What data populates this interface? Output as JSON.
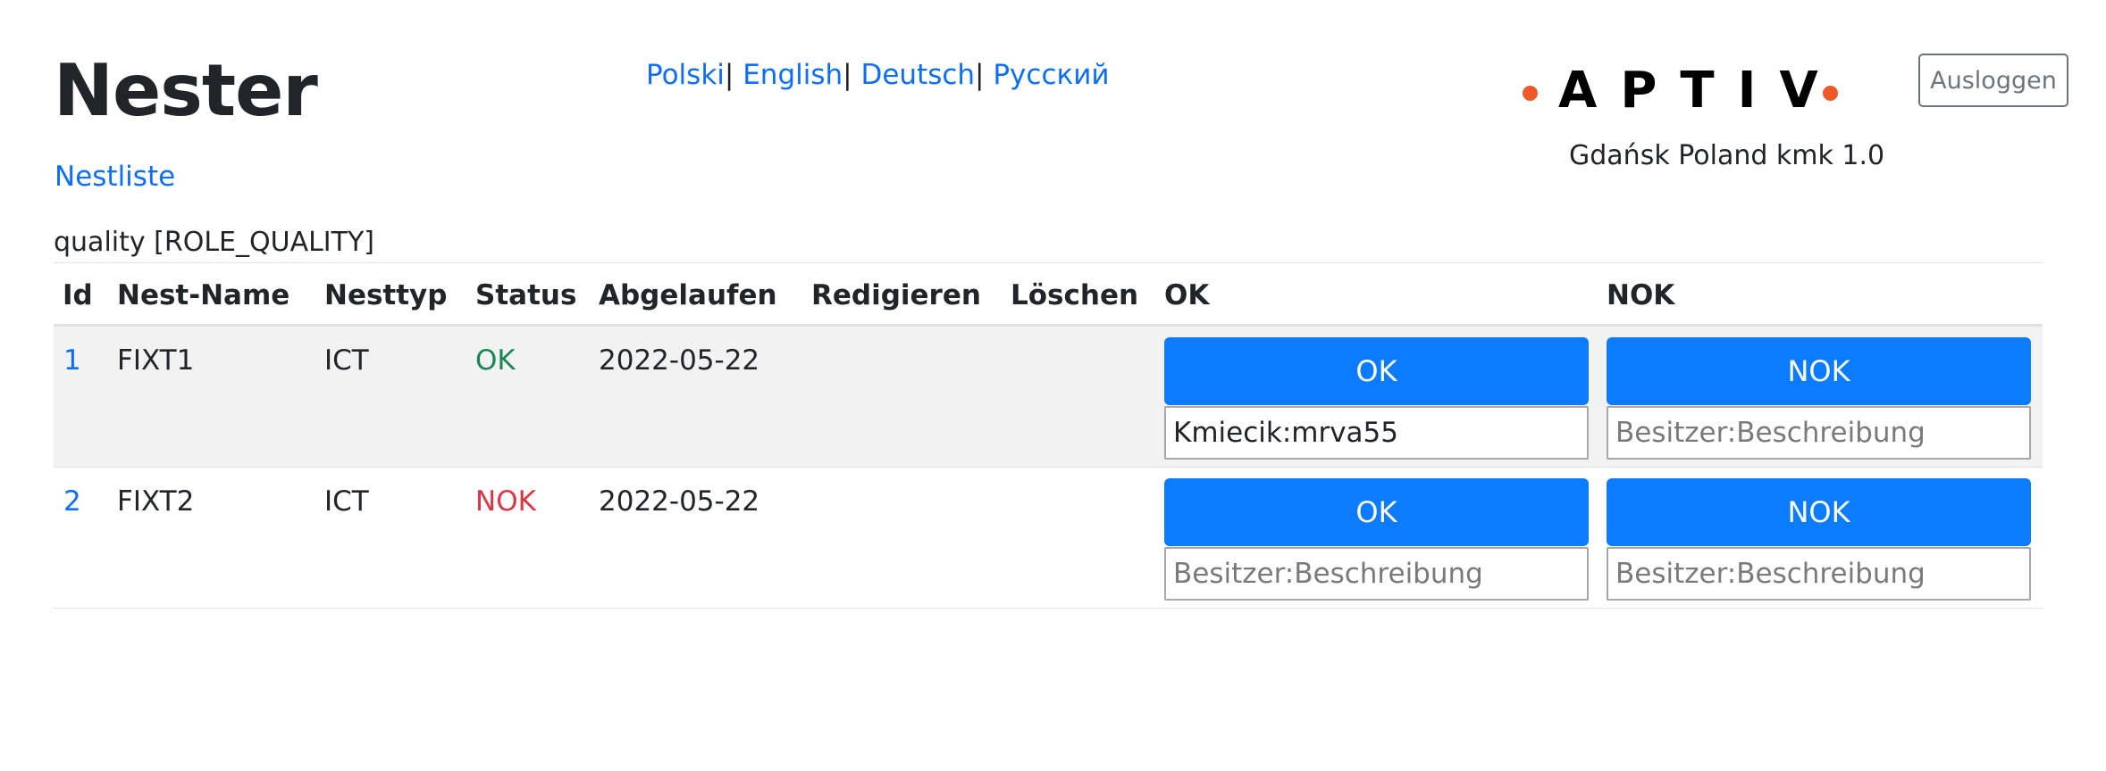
{
  "header": {
    "title": "Nester",
    "nav_link": "Nestliste",
    "languages": [
      "Polski",
      "English",
      "Deutsch",
      "Русский"
    ],
    "separator": "|",
    "logo_text": "APTIV",
    "subtitle": "Gdańsk Poland kmk 1.0",
    "logout_label": "Ausloggen",
    "user": "quality [ROLE_QUALITY]"
  },
  "table": {
    "columns": [
      "Id",
      "Nest-Name",
      "Nesttyp",
      "Status",
      "Abgelaufen",
      "Redigieren",
      "Löschen",
      "OK",
      "NOK"
    ],
    "rows": [
      {
        "id": "1",
        "name": "FIXT1",
        "type": "ICT",
        "status": "OK",
        "expired": "2022-05-22",
        "ok_button": "OK",
        "nok_button": "NOK",
        "ok_input_value": "Kmiecik:mrva55",
        "ok_input_placeholder": "Besitzer:Beschreibung",
        "nok_input_value": "",
        "nok_input_placeholder": "Besitzer:Beschreibung"
      },
      {
        "id": "2",
        "name": "FIXT2",
        "type": "ICT",
        "status": "NOK",
        "expired": "2022-05-22",
        "ok_button": "OK",
        "nok_button": "NOK",
        "ok_input_value": "",
        "ok_input_placeholder": "Besitzer:Beschreibung",
        "nok_input_value": "",
        "nok_input_placeholder": "Besitzer:Beschreibung"
      }
    ]
  },
  "colors": {
    "link": "#0d6efd",
    "primary_button": "#0d7bfd",
    "status_ok": "#198754",
    "status_nok": "#dc3545",
    "logo_accent": "#f05a28"
  }
}
